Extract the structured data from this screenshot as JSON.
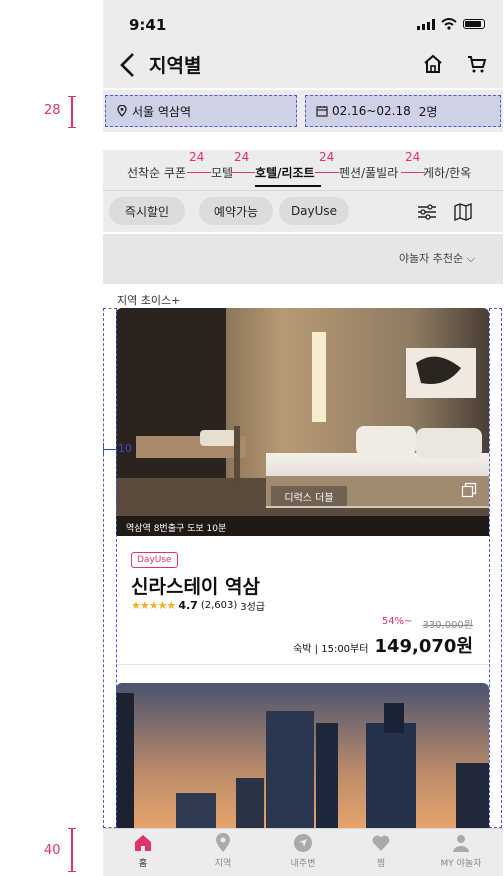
{
  "status_bar": {
    "time": "9:41"
  },
  "header": {
    "title": "지역별",
    "back_icon": "chevron-left-icon",
    "home_icon": "home-icon",
    "cart_icon": "cart-icon"
  },
  "search": {
    "location": "서울 역삼역",
    "dates": "02.16~02.18",
    "guests": "2명"
  },
  "tabs": [
    {
      "label": "선착순 쿠폰",
      "active": false
    },
    {
      "label": "모텔",
      "active": false
    },
    {
      "label": "호텔/리조트",
      "active": true
    },
    {
      "label": "펜션/풀빌라",
      "active": false
    },
    {
      "label": "게하/한옥",
      "active": false
    }
  ],
  "chips": [
    "즉시할인",
    "예약가능",
    "DayUse"
  ],
  "sort": {
    "label": "야놀자 추천순"
  },
  "section": {
    "label": "지역 초이스+"
  },
  "listing": {
    "photo_caption": "역삼역 8번출구 도보 10분",
    "room_type": "디럭스 더블",
    "badge": "DayUse",
    "name": "신라스테이 역삼",
    "rating": "4.7",
    "reviews": "(2,603)",
    "grade": "3성급",
    "discount": "54%~",
    "original_price": "330,000원",
    "stay_type": "숙박 | 15:00부터",
    "price": "149,070원"
  },
  "nav": [
    {
      "label": "홈",
      "icon": "home-icon",
      "active": true
    },
    {
      "label": "지역",
      "icon": "location-pin-icon",
      "active": false
    },
    {
      "label": "내주변",
      "icon": "navigation-icon",
      "active": false
    },
    {
      "label": "찜",
      "icon": "heart-icon",
      "active": false
    },
    {
      "label": "MY 야놀자",
      "icon": "user-icon",
      "active": false
    }
  ],
  "annotations": {
    "filter_height": "28",
    "tab_gap": "24",
    "card_margin": "10",
    "nav_height": "40"
  },
  "colors": {
    "accent": "#e0326b",
    "guide_blue": "#4a5bd8"
  }
}
